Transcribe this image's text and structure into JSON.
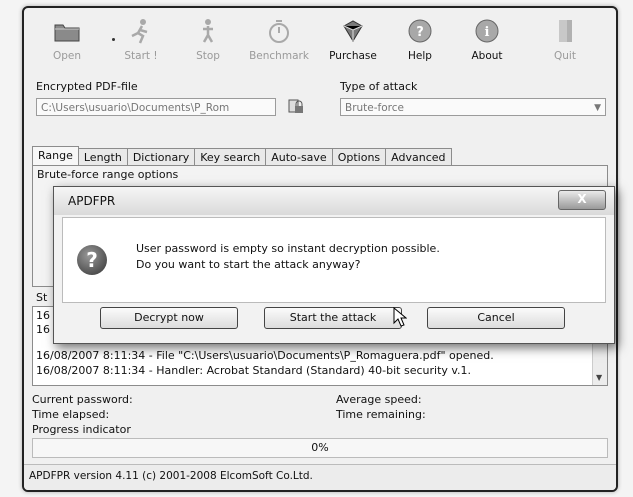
{
  "toolbar": {
    "open": "Open",
    "start": "Start !",
    "stop": "Stop",
    "benchmark": "Benchmark",
    "purchase": "Purchase",
    "help": "Help",
    "about": "About",
    "quit": "Quit"
  },
  "encrypted_file": {
    "label": "Encrypted PDF-file",
    "value": "C:\\Users\\usuario\\Documents\\P_Rom"
  },
  "attack_type": {
    "label": "Type of attack",
    "value": "Brute-force"
  },
  "tabs": [
    "Range",
    "Length",
    "Dictionary",
    "Key search",
    "Auto-save",
    "Options",
    "Advanced"
  ],
  "range_panel": {
    "title": "Brute-force range options"
  },
  "status_label": "St",
  "log": {
    "partial1": "16",
    "partial2": "16",
    "line3": "16/08/2007 8:11:34 - File \"C:\\Users\\usuario\\Documents\\P_Romaguera.pdf\" opened.",
    "line4": "16/08/2007 8:11:34 - Handler: Acrobat Standard (Standard) 40-bit security v.1."
  },
  "stats": {
    "current_password": "Current password:",
    "time_elapsed": "Time elapsed:",
    "progress_indicator": "Progress indicator",
    "average_speed": "Average speed:",
    "time_remaining": "Time remaining:"
  },
  "progress": {
    "percent": 0,
    "text": "0%"
  },
  "statusbar": "APDFPR version 4.11 (c) 2001-2008 ElcomSoft Co.Ltd.",
  "dialog": {
    "title": "APDFPR",
    "close": "X",
    "message1": "User password is empty so instant decryption possible.",
    "message2": "Do you want to start the attack anyway?",
    "decrypt_now": "Decrypt now",
    "start_attack": "Start the attack",
    "cancel": "Cancel",
    "icon": "question-icon"
  },
  "colors": {
    "frame": "#222222",
    "background": "#f0f0f0",
    "disabled_text": "#9a9a9a"
  }
}
